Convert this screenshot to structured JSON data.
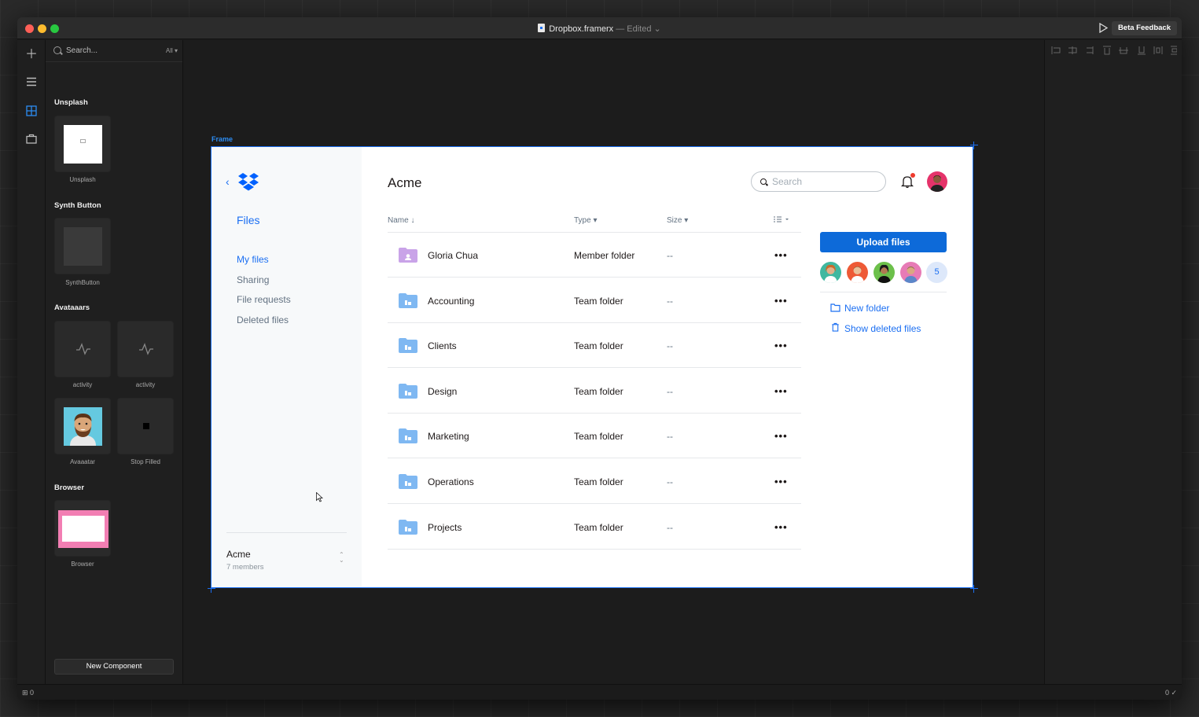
{
  "window": {
    "file_name": "Dropbox.framerx",
    "edited_label": "— Edited",
    "beta_feedback": "Beta Feedback"
  },
  "panel": {
    "search_placeholder": "Search...",
    "filter": "All",
    "sections": [
      {
        "title": "Unsplash",
        "items": [
          "Unsplash"
        ]
      },
      {
        "title": "Synth Button",
        "items": [
          "SynthButton"
        ]
      },
      {
        "title": "Avataaars",
        "items": [
          "activity",
          "activity",
          "Avaaatar",
          "Stop Filled"
        ]
      },
      {
        "title": "Browser",
        "items": [
          "Browser"
        ]
      }
    ],
    "new_component": "New Component"
  },
  "status": {
    "left_count": "0",
    "right_count": "0"
  },
  "frame": {
    "label": "Frame"
  },
  "dropbox": {
    "sidebar": {
      "files": "Files",
      "nav": [
        "My files",
        "Sharing",
        "File requests",
        "Deleted files"
      ],
      "active_index": 0,
      "team_name": "Acme",
      "team_members": "7 members"
    },
    "title": "Acme",
    "search_placeholder": "Search",
    "columns": {
      "name": "Name",
      "type": "Type",
      "size": "Size"
    },
    "rows": [
      {
        "name": "Gloria Chua",
        "type": "Member folder",
        "size": "--",
        "kind": "member"
      },
      {
        "name": "Accounting",
        "type": "Team folder",
        "size": "--",
        "kind": "team"
      },
      {
        "name": "Clients",
        "type": "Team folder",
        "size": "--",
        "kind": "team"
      },
      {
        "name": "Design",
        "type": "Team folder",
        "size": "--",
        "kind": "team"
      },
      {
        "name": "Marketing",
        "type": "Team folder",
        "size": "--",
        "kind": "team"
      },
      {
        "name": "Operations",
        "type": "Team folder",
        "size": "--",
        "kind": "team"
      },
      {
        "name": "Projects",
        "type": "Team folder",
        "size": "--",
        "kind": "team"
      }
    ],
    "upload_button": "Upload files",
    "member_more": "5",
    "actions": [
      "New folder",
      "Show deleted files"
    ],
    "colors": {
      "accent": "#1b6ff2",
      "button": "#0d6ad9",
      "team_folder": "#7fb8f2",
      "member_folder": "#c9a3e8"
    }
  }
}
